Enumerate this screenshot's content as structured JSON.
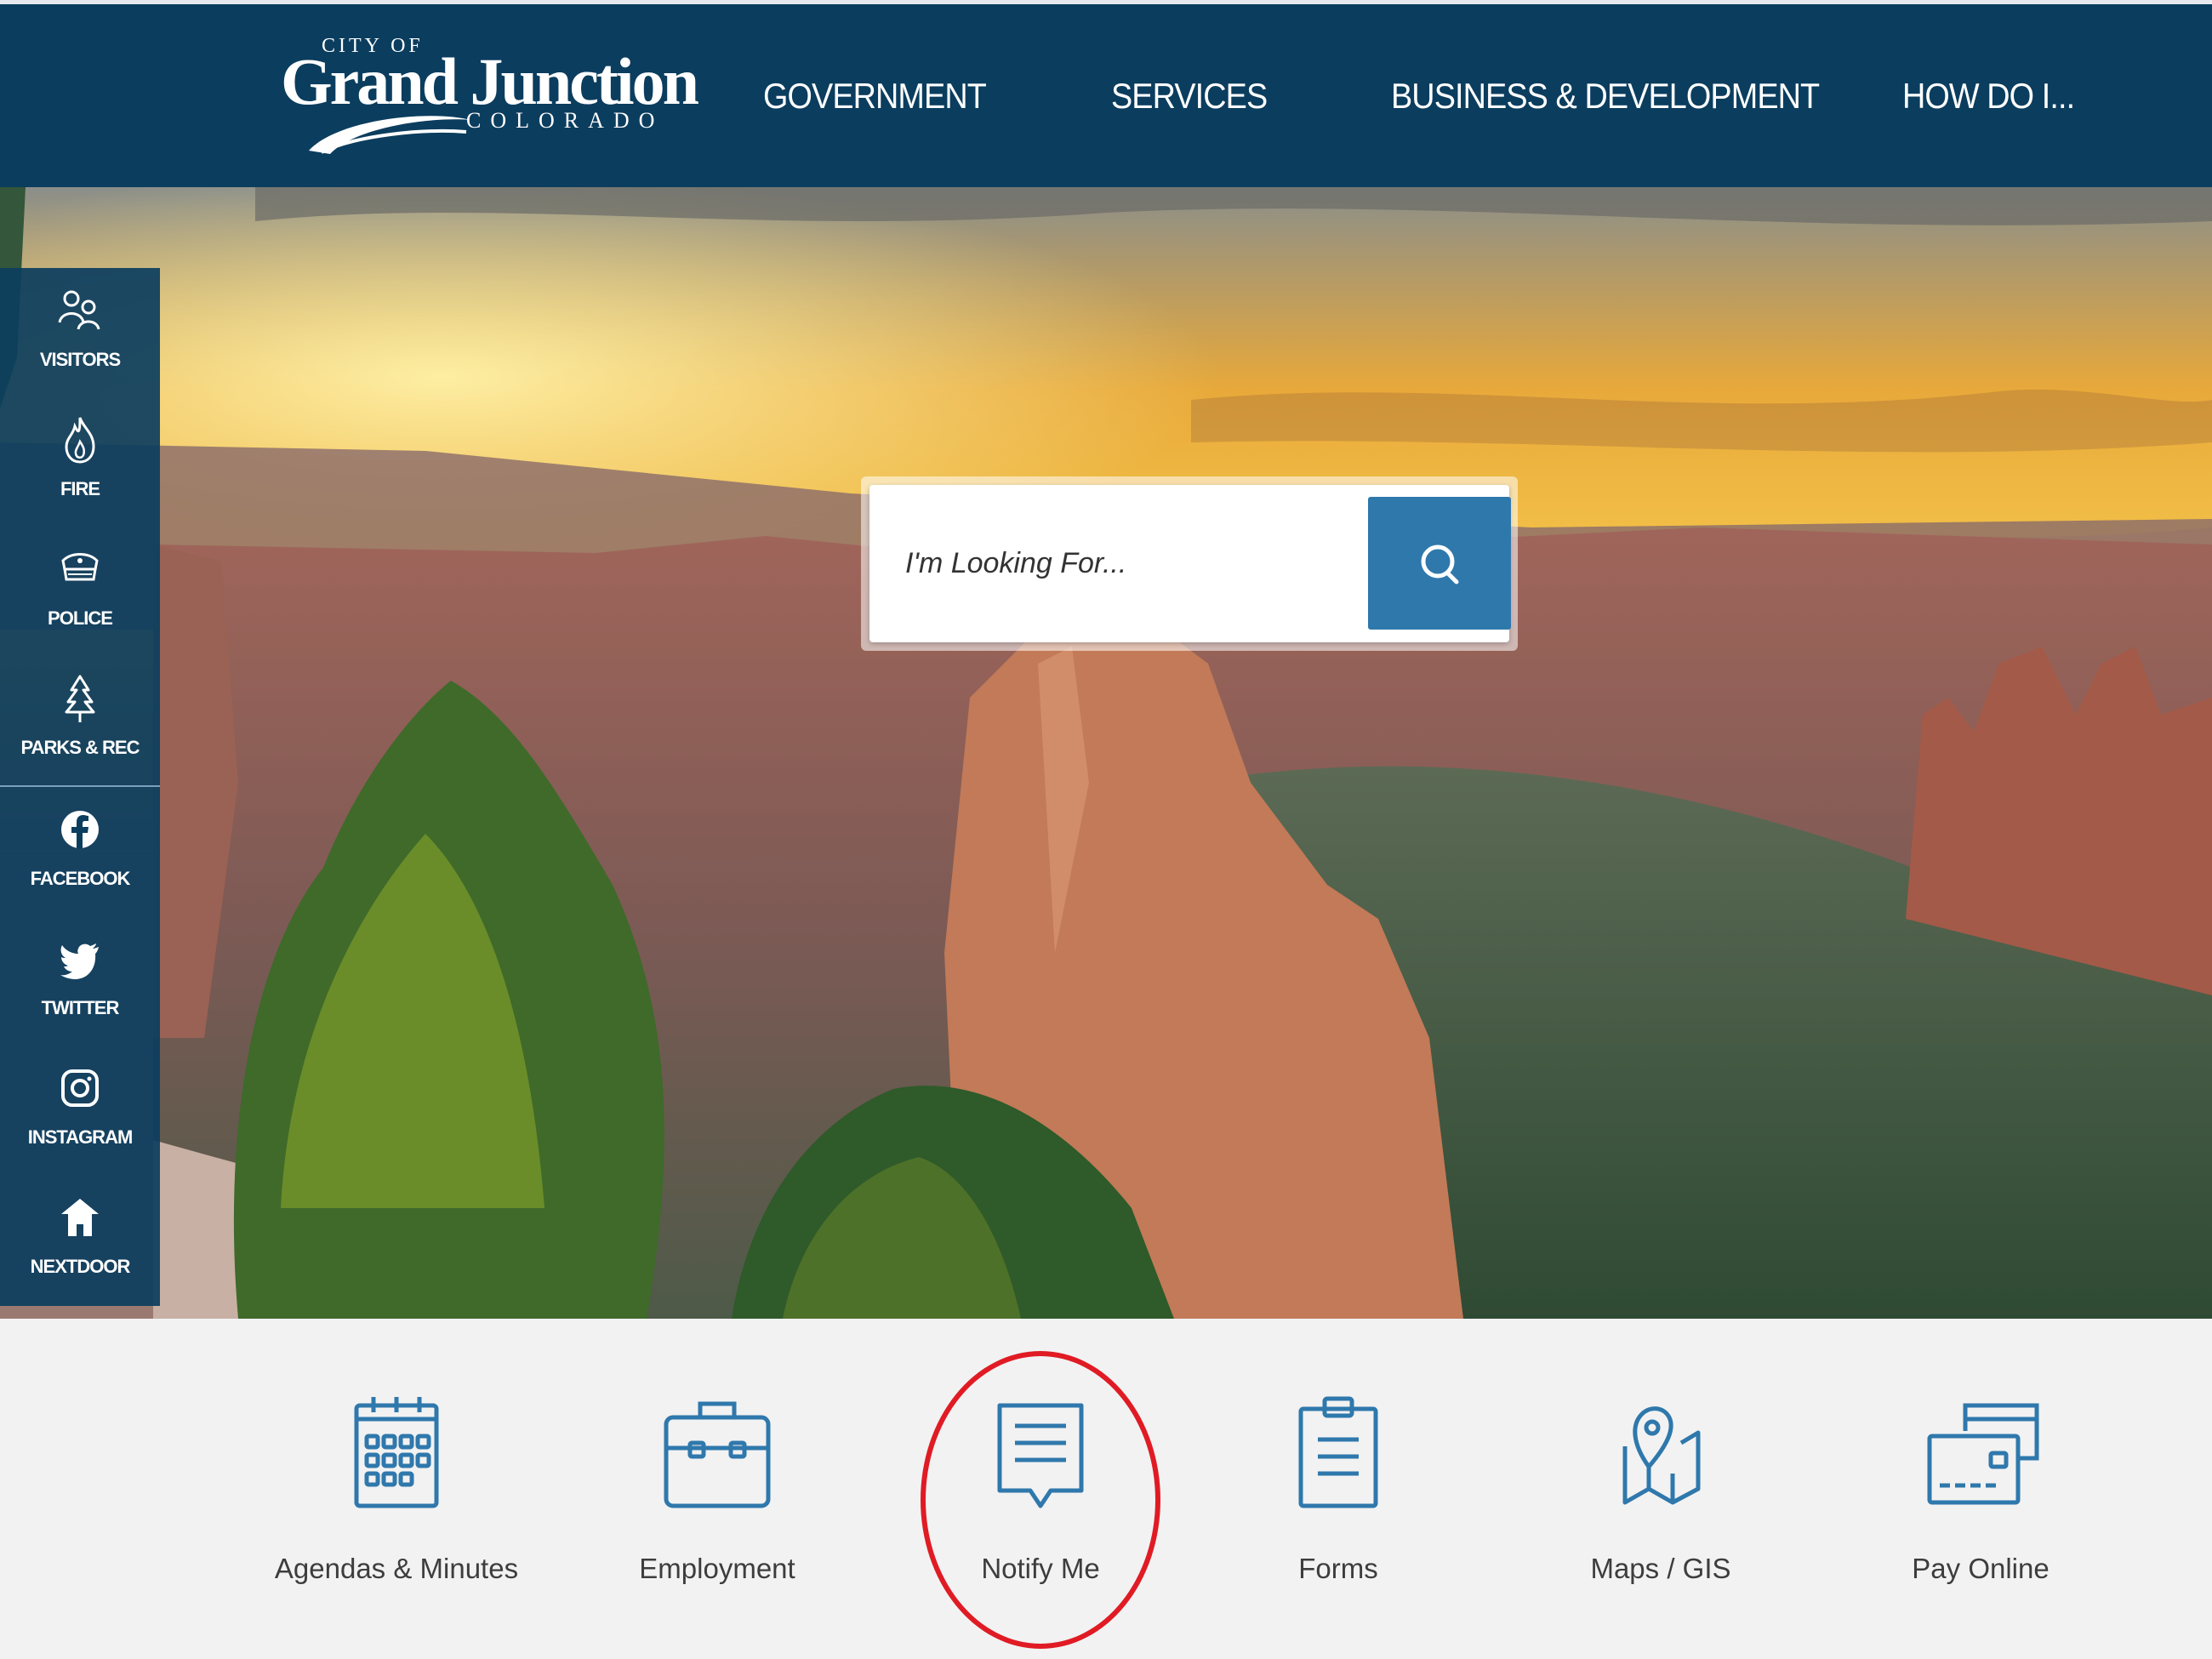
{
  "header": {
    "logo": {
      "line1": "CITY OF",
      "line2": "Grand Junction",
      "line3": "COLORADO"
    },
    "nav": [
      {
        "label": "GOVERNMENT"
      },
      {
        "label": "SERVICES"
      },
      {
        "label": "BUSINESS & DEVELOPMENT"
      },
      {
        "label": "HOW DO I..."
      }
    ]
  },
  "sidebar": {
    "items": [
      {
        "label": "VISITORS",
        "icon": "visitors-icon"
      },
      {
        "label": "FIRE",
        "icon": "flame-icon"
      },
      {
        "label": "POLICE",
        "icon": "police-badge-icon"
      },
      {
        "label": "PARKS & REC",
        "icon": "tree-icon"
      },
      {
        "label": "FACEBOOK",
        "icon": "facebook-icon"
      },
      {
        "label": "TWITTER",
        "icon": "twitter-icon"
      },
      {
        "label": "INSTAGRAM",
        "icon": "instagram-icon"
      },
      {
        "label": "NEXTDOOR",
        "icon": "nextdoor-icon"
      }
    ]
  },
  "search": {
    "placeholder": "I'm Looking For...",
    "button_icon": "search-icon"
  },
  "quick_links": [
    {
      "label": "Agendas & Minutes",
      "icon": "calendar-icon"
    },
    {
      "label": "Employment",
      "icon": "briefcase-icon"
    },
    {
      "label": "Notify Me",
      "icon": "message-icon",
      "highlighted": true
    },
    {
      "label": "Forms",
      "icon": "clipboard-icon"
    },
    {
      "label": "Maps / GIS",
      "icon": "map-pin-icon"
    },
    {
      "label": "Pay Online",
      "icon": "credit-card-icon"
    }
  ],
  "colors": {
    "header_bg": "#0b3d5e",
    "search_button": "#2f78ac",
    "quick_icon": "#2f78ac",
    "highlight_ring": "#e01b24"
  }
}
